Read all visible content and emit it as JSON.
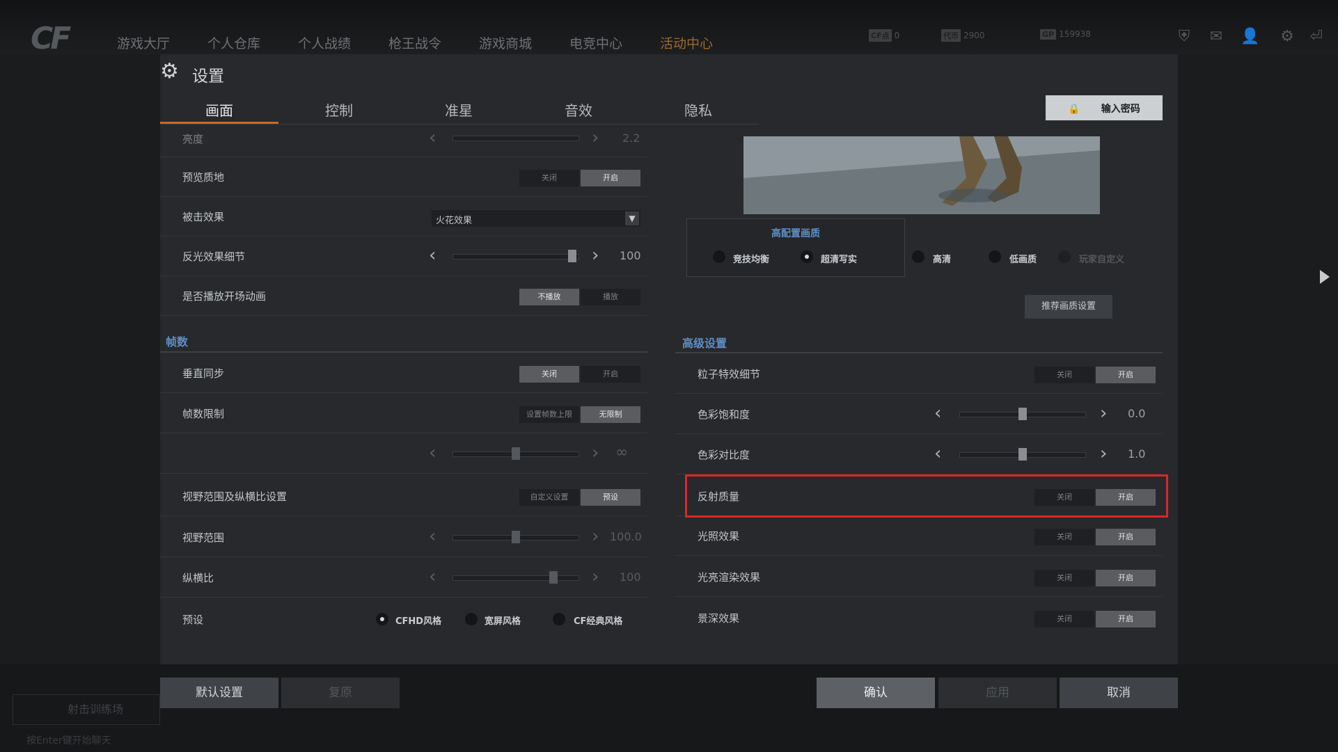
{
  "topbar": {
    "logo": "CF",
    "nav": [
      "游戏大厅",
      "个人仓库",
      "个人战绩",
      "枪王战令",
      "游戏商城",
      "电竞中心",
      "活动中心"
    ],
    "hud": [
      {
        "tag": "CF点",
        "value": "0"
      },
      {
        "tag": "代币",
        "value": "2900"
      },
      {
        "tag": "GP",
        "value": "159938"
      }
    ]
  },
  "dialog": {
    "title": "设置",
    "tabs": [
      "画面",
      "控制",
      "准星",
      "音效",
      "隐私"
    ],
    "password_button": "输入密码",
    "left": {
      "brightness_label": "亮度",
      "brightness_value": "2.2",
      "rows": {
        "preview_texture": {
          "label": "预览质地",
          "off": "关闭",
          "on": "开启"
        },
        "hit_effect": {
          "label": "被击效果",
          "value": "火花效果"
        },
        "reflection_detail": {
          "label": "反光效果细节",
          "value": "100",
          "level": 0.98
        },
        "intro_anim": {
          "label": "是否播放开场动画",
          "off": "不播放",
          "on": "播放"
        }
      },
      "fps_section": "帧数",
      "fps_rows": {
        "vsync": {
          "label": "垂直同步",
          "off": "关闭",
          "on": "开启"
        },
        "fps_limit": {
          "label": "帧数限制",
          "off": "设置帧数上限",
          "on": "无限制"
        },
        "fps_slider": {
          "value": "∞",
          "level": 0.5
        },
        "fov_aspect": {
          "label": "视野范围及纵横比设置",
          "off": "自定义设置",
          "on": "预设"
        },
        "fov": {
          "label": "视野范围",
          "value": "100.0",
          "level": 0.5
        },
        "aspect": {
          "label": "纵横比",
          "value": "100",
          "level": 0.82
        },
        "preset": {
          "label": "预设",
          "options": [
            "CFHD风格",
            "宽屏风格",
            "CF经典风格"
          ]
        }
      }
    },
    "right": {
      "quality_title": "高配置画质",
      "quality_options": [
        "竞技均衡",
        "超清写实",
        "高清",
        "低画质",
        "玩家自定义"
      ],
      "recommend_button": "推荐画质设置",
      "advanced_section": "高级设置",
      "rows": {
        "particle": {
          "label": "粒子特效细节",
          "off": "关闭",
          "on": "开启"
        },
        "saturation": {
          "label": "色彩饱和度",
          "value": "0.0",
          "level": 0.5
        },
        "contrast": {
          "label": "色彩对比度",
          "value": "1.0",
          "level": 0.5
        },
        "reflection_quality": {
          "label": "反射质量",
          "off": "关闭",
          "on": "开启"
        },
        "lighting": {
          "label": "光照效果",
          "off": "关闭",
          "on": "开启"
        },
        "bloom": {
          "label": "光亮渲染效果",
          "off": "关闭",
          "on": "开启"
        },
        "dof": {
          "label": "景深效果",
          "off": "关闭",
          "on": "开启"
        }
      }
    },
    "buttons": {
      "default": "默认设置",
      "restore": "复原",
      "confirm": "确认",
      "apply": "应用",
      "cancel": "取消"
    }
  },
  "bottombar": {
    "training": "射击训练场",
    "enter_tip": "按Enter键开始聊天"
  }
}
